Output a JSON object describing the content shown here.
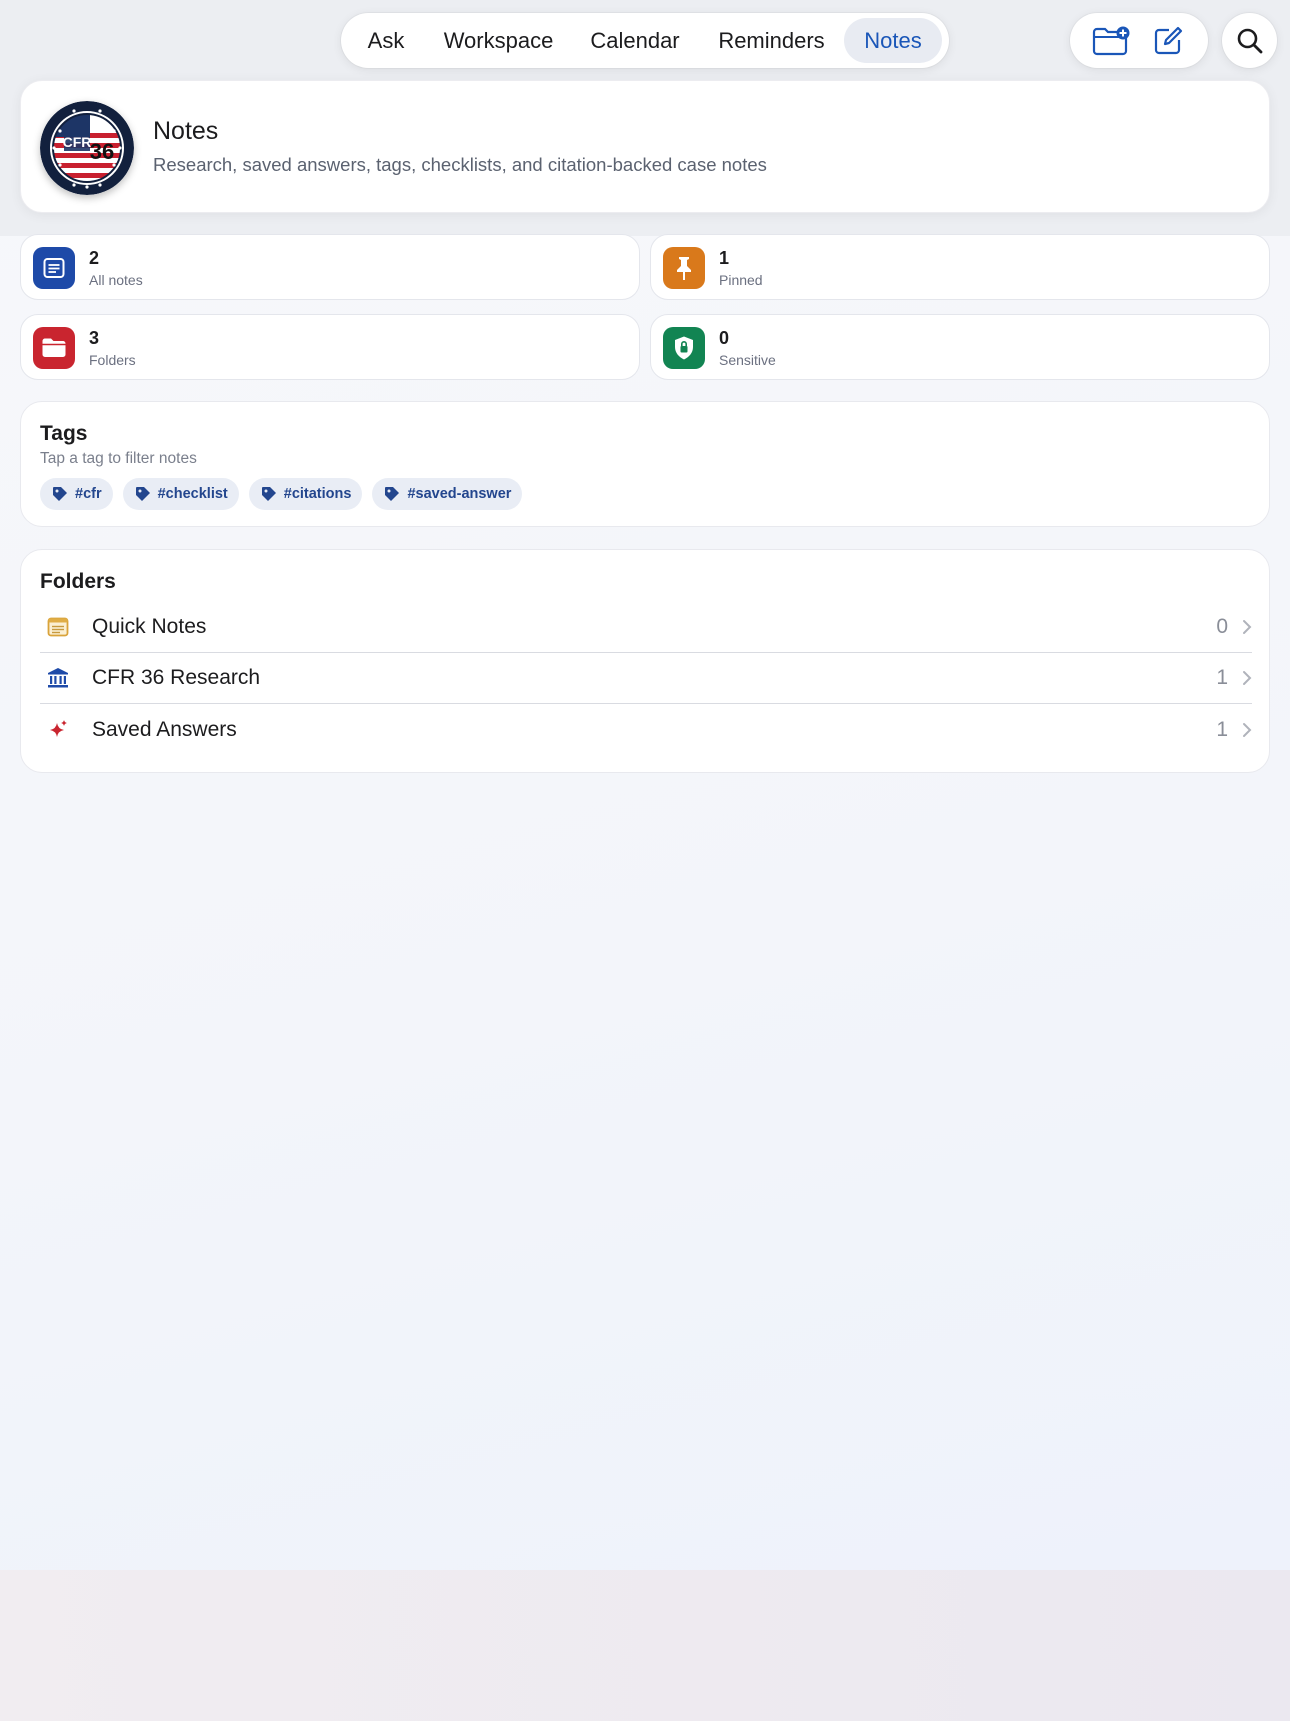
{
  "nav": {
    "tabs": [
      {
        "label": "Ask"
      },
      {
        "label": "Workspace"
      },
      {
        "label": "Calendar"
      },
      {
        "label": "Reminders"
      },
      {
        "label": "Notes"
      }
    ],
    "active_tab": "Notes",
    "actions": [
      "new-folder-icon",
      "compose-icon",
      "search-icon"
    ]
  },
  "header": {
    "title": "Notes",
    "subtitle": "Research, saved answers, tags, checklists, and citation-backed case notes",
    "logo": {
      "text_cfr": "CFR",
      "text_num": "36"
    }
  },
  "stats": [
    {
      "value": "2",
      "label": "All notes",
      "icon": "notes-list-icon",
      "color": "#1e4aa8"
    },
    {
      "value": "1",
      "label": "Pinned",
      "icon": "pin-icon",
      "color": "#d9791b"
    },
    {
      "value": "3",
      "label": "Folders",
      "icon": "folder-icon",
      "color": "#c9252f"
    },
    {
      "value": "0",
      "label": "Sensitive",
      "icon": "lock-shield-icon",
      "color": "#128452"
    }
  ],
  "tags": {
    "title": "Tags",
    "subtitle": "Tap a tag to filter notes",
    "items": [
      "#cfr",
      "#checklist",
      "#citations",
      "#saved-answer"
    ]
  },
  "folders": {
    "title": "Folders",
    "items": [
      {
        "name": "Quick Notes",
        "count": "0",
        "icon": "note-icon"
      },
      {
        "name": "CFR 36 Research",
        "count": "1",
        "icon": "building-columns-icon"
      },
      {
        "name": "Saved Answers",
        "count": "1",
        "icon": "sparkles-icon"
      }
    ]
  },
  "colors": {
    "accent": "#1a56b8",
    "tag_text": "#23468e",
    "tag_bg": "#e9edf5"
  }
}
